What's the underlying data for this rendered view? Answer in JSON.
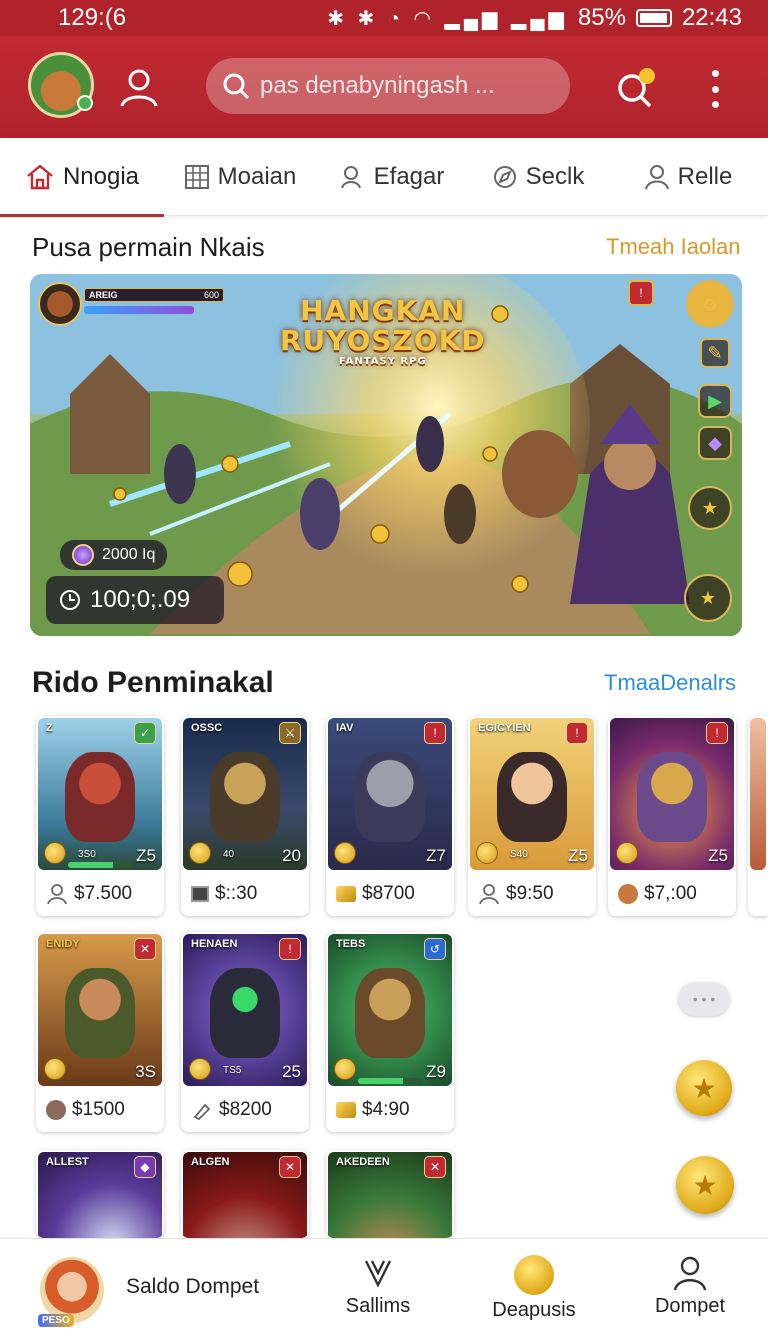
{
  "status_bar": {
    "time": "129:(6",
    "battery": "85%",
    "clock": "22:43",
    "battery_level": 0.85
  },
  "header": {
    "search_placeholder": "pas denabyningash ..."
  },
  "tabs": [
    {
      "label": "Nnogia",
      "icon": "home-icon"
    },
    {
      "label": "Moaian",
      "icon": "grid-icon"
    },
    {
      "label": "Efagar",
      "icon": "user-search-icon"
    },
    {
      "label": "Seclk",
      "icon": "compass-icon"
    },
    {
      "label": "Relle",
      "icon": "person-icon"
    }
  ],
  "featured": {
    "title": "Pusa permain Nkais",
    "link": "Tmeah Iaolan",
    "banner": {
      "title_line1": "HANGKAN",
      "title_line2": "RUYOSZOKD",
      "subtitle": "FANTASY RPG",
      "hud_name": "AREIG",
      "hud_value": "600",
      "gems": "2000 Iq",
      "timer": "100;0;.09"
    }
  },
  "recommended": {
    "title": "Rido Penminakal",
    "link": "TmaaDenalrs",
    "row1": [
      {
        "label": "Z",
        "price": "$7.500",
        "level": "Z5",
        "mid": "3S0",
        "icon": "person-icon"
      },
      {
        "label": "OSSC",
        "price": "$::30",
        "level": "20",
        "mid": "40",
        "icon": "card-icon"
      },
      {
        "label": "IAV",
        "price": "$8700",
        "level": "Z7",
        "mid": "",
        "icon": "gold-icon"
      },
      {
        "label": "EGICYIEN",
        "price": "$9:50",
        "level": "Z5",
        "mid": "S40",
        "icon": "person-icon"
      },
      {
        "label": "",
        "price": "$7,:00",
        "level": "Z5",
        "mid": "",
        "icon": "fox-icon"
      }
    ],
    "row2": [
      {
        "label": "ENIDY",
        "price": "$1500",
        "level": "3S",
        "mid": "",
        "icon": "fox-icon"
      },
      {
        "label": "HENAEN",
        "price": "$8200",
        "level": "25",
        "mid": "TS5",
        "icon": "pencil-icon"
      },
      {
        "label": "TEBS",
        "price": "$4:90",
        "level": "Z9",
        "mid": "",
        "icon": "gold-icon"
      }
    ],
    "row3": [
      {
        "label": "ALLEST"
      },
      {
        "label": "ALGEN"
      },
      {
        "label": "AKEDEEN"
      }
    ]
  },
  "bottom_nav": {
    "wallet_label": "Saldo Dompet",
    "avatar_tag": "PESO",
    "items": [
      {
        "label": "Sallims",
        "icon": "trophy-icon"
      },
      {
        "label": "Deapusis",
        "icon": "coin-icon"
      },
      {
        "label": "Dompet",
        "icon": "person-icon"
      }
    ]
  },
  "colors": {
    "brand": "#c12a32",
    "accent_gold": "#d39a16",
    "link_gold": "#d9982a",
    "link_blue": "#2a8fd8"
  }
}
